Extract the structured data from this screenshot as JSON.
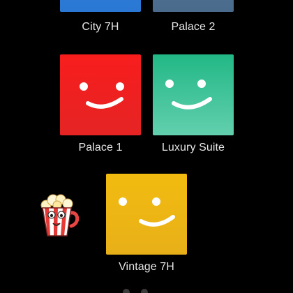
{
  "profiles": [
    {
      "name": "City 7H",
      "color": "#2b7bd8",
      "color2": "#1f66bb",
      "avatar_icon": "smiley-face-icon"
    },
    {
      "name": "Palace 2",
      "color": "#4d6f8c",
      "color2": "#3e5d78",
      "avatar_icon": "smiley-face-icon"
    },
    {
      "name": "Palace 1",
      "color": "#f11c1c",
      "color2": "#cf1f1f",
      "avatar_icon": "smiley-face-icon"
    },
    {
      "name": "Luxury Suite",
      "color": "#2ebc90",
      "color2": "#5ccaa7",
      "avatar_icon": "smiley-face-icon"
    },
    {
      "name": "Vintage 7H",
      "color": "#f0b712",
      "color2": "#e3a90e",
      "avatar_icon": "smiley-face-icon"
    }
  ],
  "sticker": {
    "icon": "popcorn-sticker-icon"
  },
  "colors": {
    "background": "#000000",
    "label": "#e6e6e6"
  }
}
